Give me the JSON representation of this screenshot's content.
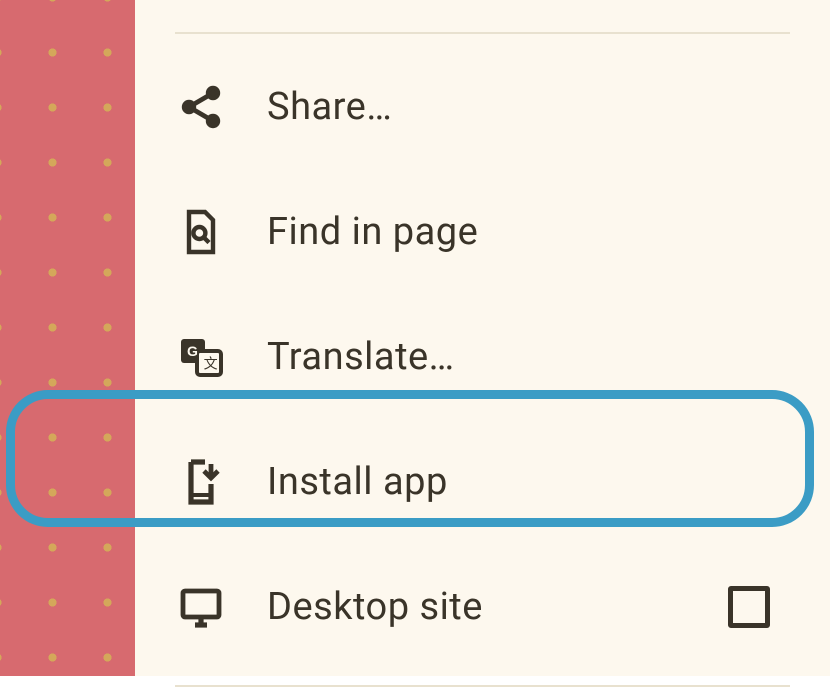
{
  "menu": {
    "items": [
      {
        "id": "share",
        "label": "Share…",
        "icon": "share-icon"
      },
      {
        "id": "find",
        "label": "Find in page",
        "icon": "find-in-page-icon"
      },
      {
        "id": "translate",
        "label": "Translate…",
        "icon": "translate-icon"
      },
      {
        "id": "install",
        "label": "Install app",
        "icon": "install-app-icon"
      },
      {
        "id": "desktop",
        "label": "Desktop site",
        "icon": "desktop-icon",
        "checkbox": true,
        "checked": false
      }
    ]
  },
  "highlight": {
    "item": "install"
  },
  "colors": {
    "text": "#3a3429",
    "panel": "#fdf8ee",
    "bg": "#d76a6f",
    "dots": "#d4a75a",
    "callout": "#3b9cc5",
    "divider": "#e8e1cf"
  }
}
